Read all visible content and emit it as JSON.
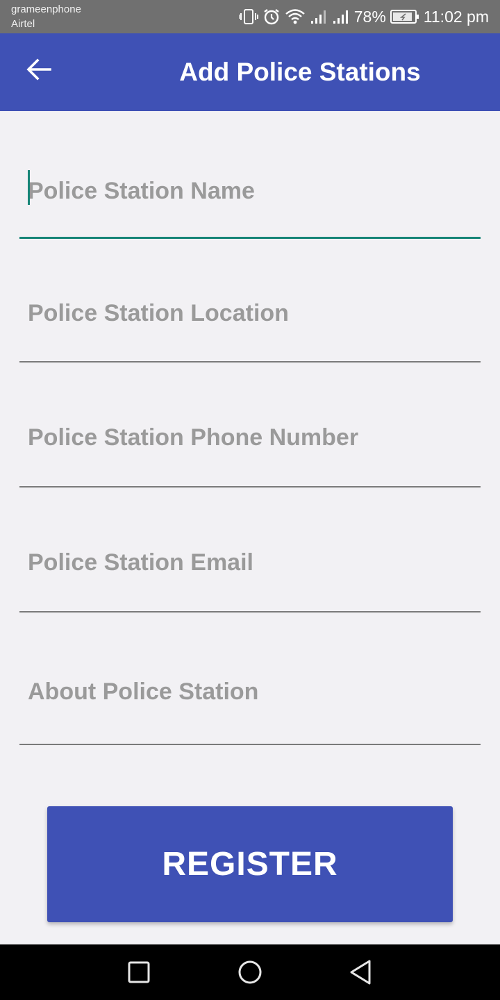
{
  "status_bar": {
    "carrier_1": "grameenphone",
    "carrier_2": "Airtel",
    "battery": "78%",
    "time": "11:02 pm",
    "icons": [
      "vibrate-icon",
      "alarm-icon",
      "wifi-icon",
      "signal-icon",
      "signal-icon",
      "battery-icon"
    ]
  },
  "app_bar": {
    "title": "Add Police Stations",
    "back_icon": "arrow-left-icon",
    "color": "#3f51b5"
  },
  "form": {
    "fields": [
      {
        "placeholder": "Police Station Name",
        "value": "",
        "focused": true
      },
      {
        "placeholder": "Police Station Location",
        "value": ""
      },
      {
        "placeholder": "Police Station Phone Number",
        "value": ""
      },
      {
        "placeholder": "Police Station Email",
        "value": ""
      },
      {
        "placeholder": "About Police Station",
        "value": ""
      }
    ],
    "accent_color": "#178577"
  },
  "register_button": {
    "label": "REGISTER"
  },
  "nav_bar": {
    "icons": [
      "recent-apps-icon",
      "home-icon",
      "back-nav-icon"
    ]
  }
}
